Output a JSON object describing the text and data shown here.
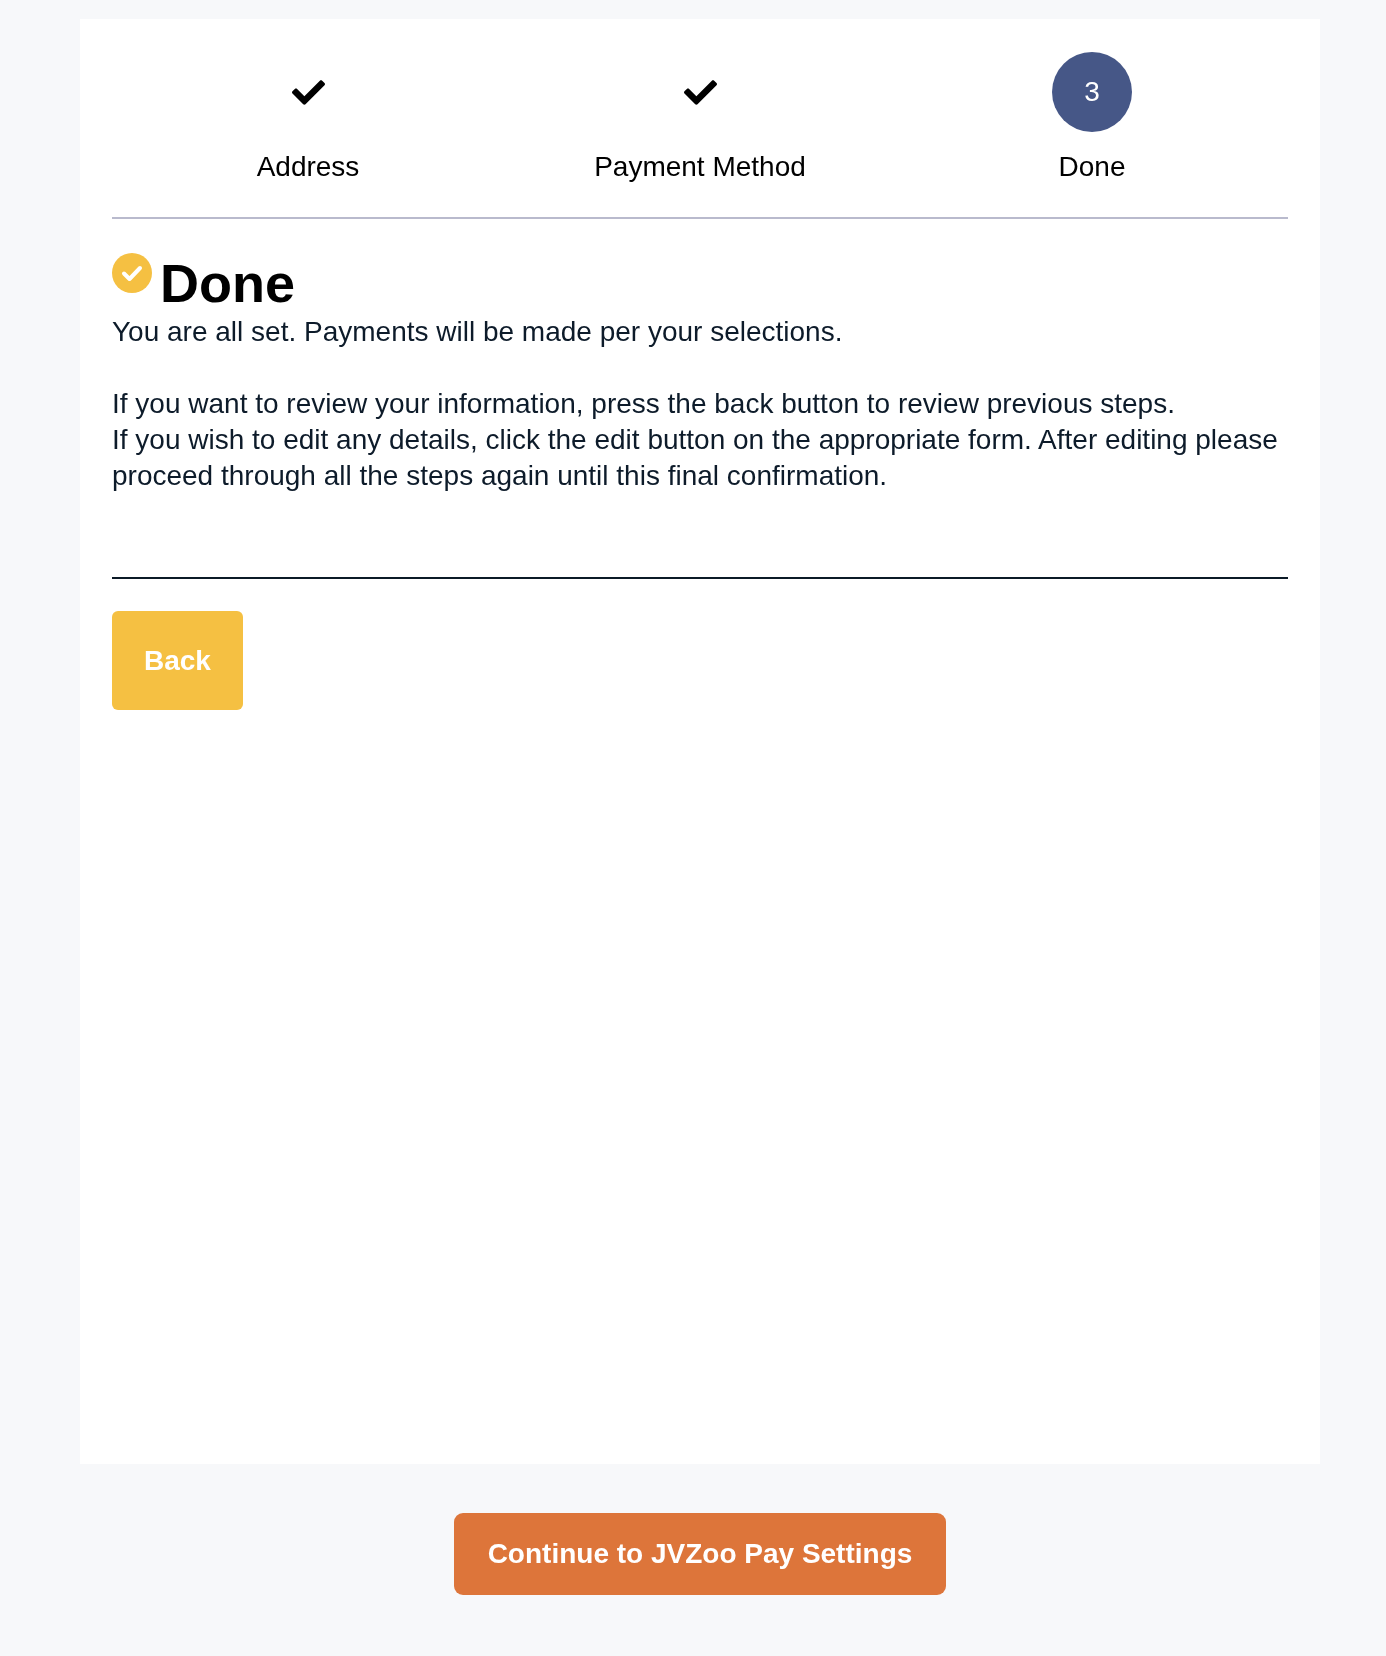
{
  "steps": [
    {
      "label": "Address",
      "completed": true
    },
    {
      "label": "Payment Method",
      "completed": true
    },
    {
      "label": "Done",
      "completed": false,
      "number": "3"
    }
  ],
  "title": "Done",
  "message": "You are all set. Payments will be made per your selections.",
  "instructions": [
    "If you want to review your information, press the back button to review previous steps.",
    "If you wish to edit any details, click the edit button on the appropriate form. After editing please proceed through all the steps again until this final confirmation."
  ],
  "back_button": "Back",
  "continue_button": "Continue to JVZoo Pay Settings"
}
